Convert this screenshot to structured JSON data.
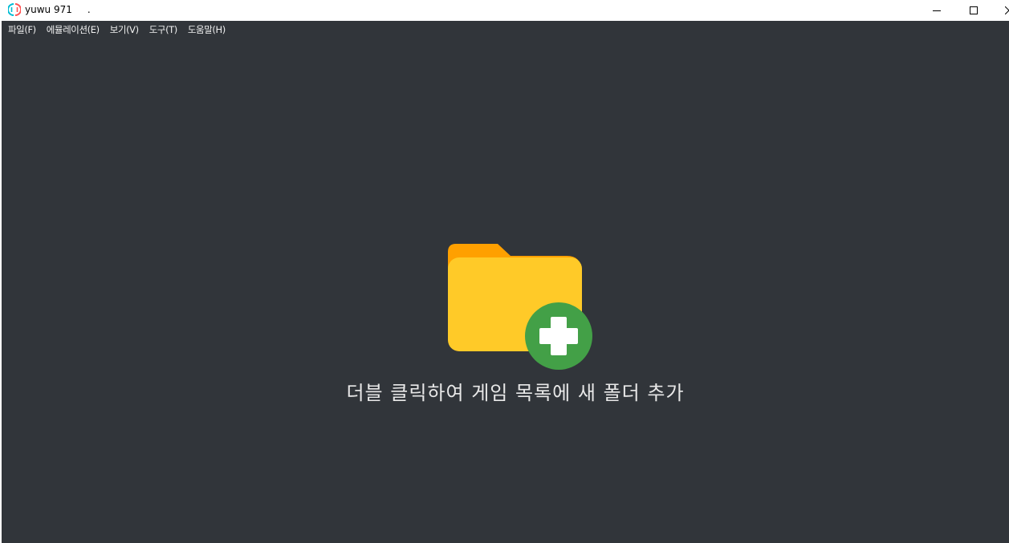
{
  "window": {
    "title": "yuwu 971     .",
    "icon": "yuzu-logo-icon",
    "controls": {
      "minimize": "minimize-icon",
      "maximize": "maximize-icon",
      "close": "close-icon"
    }
  },
  "menu": {
    "items": [
      {
        "label": "파일(F)"
      },
      {
        "label": "에뮬레이션(E)"
      },
      {
        "label": "보기(V)"
      },
      {
        "label": "도구(T)"
      },
      {
        "label": "도움말(H)"
      }
    ]
  },
  "main": {
    "hint": "더블 클릭하여 게임 목록에 새 폴더 추가",
    "icon": "add-folder-icon"
  },
  "colors": {
    "background": "#31353a",
    "folder_back": "#ffa000",
    "folder_front": "#ffca28",
    "plus_circle": "#43a047",
    "plus_sign": "#ffffff",
    "logo_left": "#00bcd4",
    "logo_right": "#ff5252"
  }
}
